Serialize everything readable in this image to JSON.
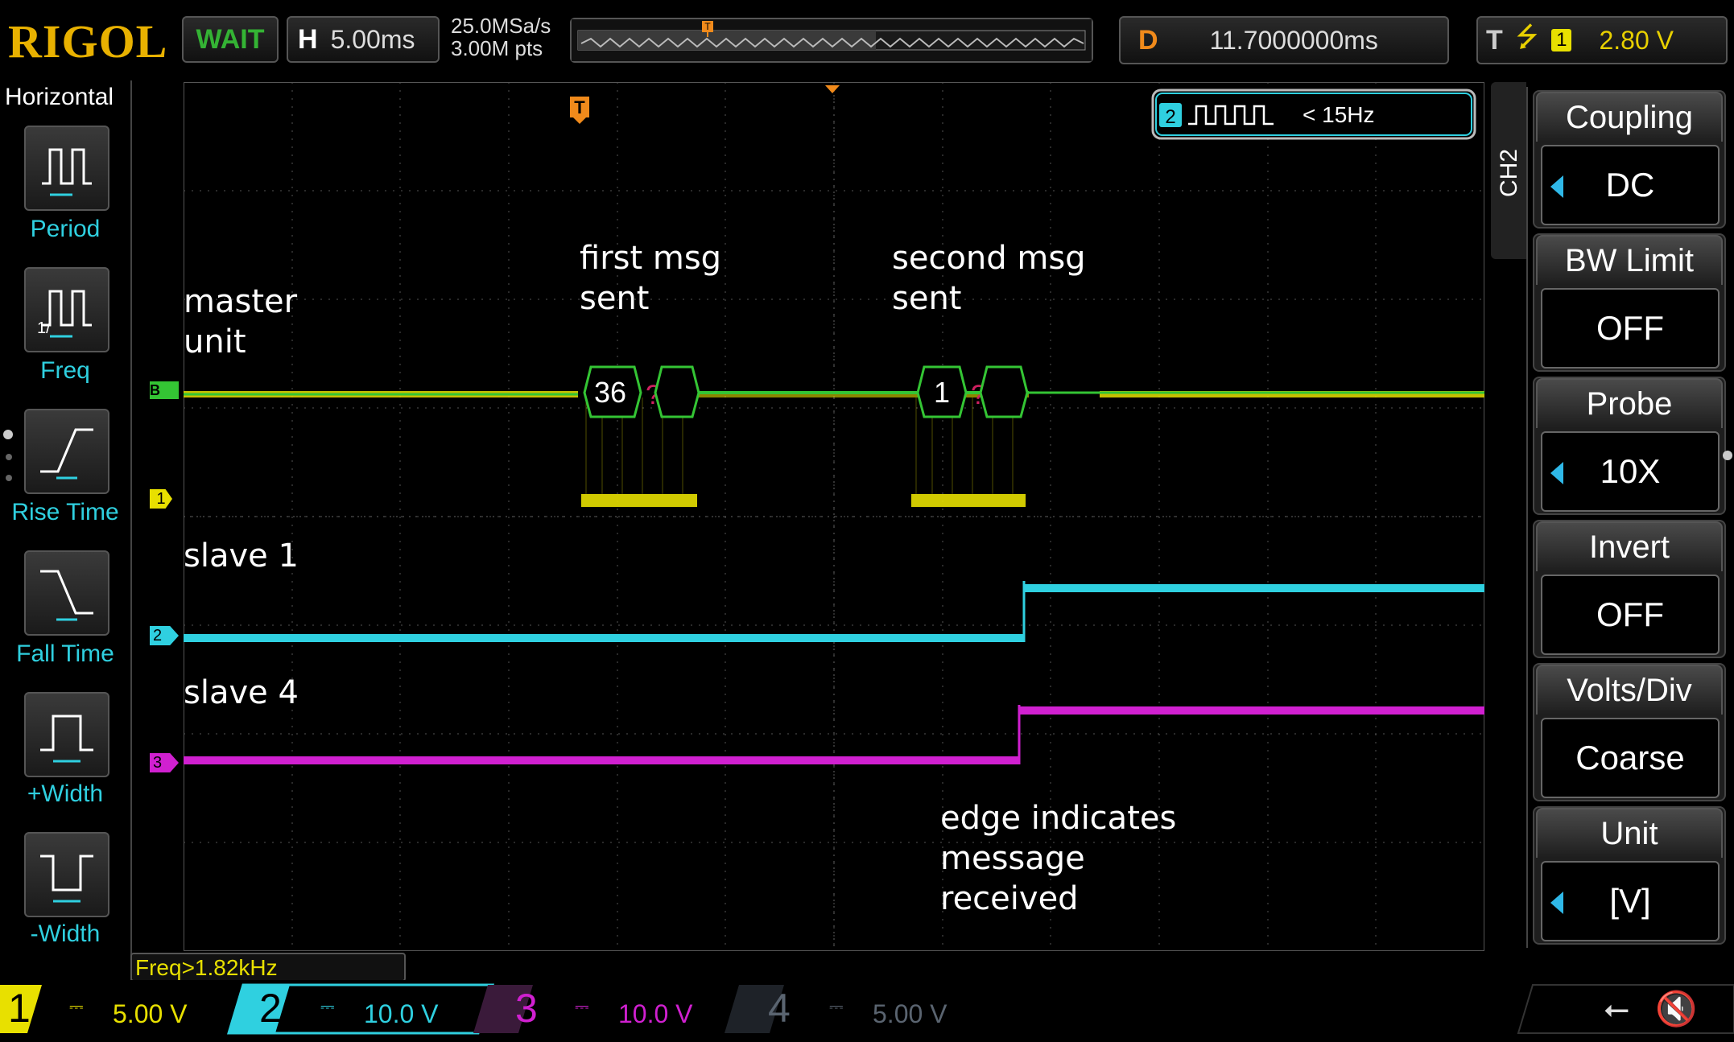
{
  "brand": "RIGOL",
  "status": "WAIT",
  "horizontal": {
    "label": "H",
    "timebase": "5.00ms",
    "sample_rate": "25.0MSa/s",
    "mem_depth": "3.00M pts"
  },
  "delay": {
    "label": "D",
    "value": "11.7000000ms"
  },
  "trigger": {
    "label": "T",
    "source": "1",
    "level": "2.80 V"
  },
  "left_menu": {
    "title": "Horizontal",
    "items": [
      {
        "label": "Period",
        "icon": "period-icon"
      },
      {
        "label": "Freq",
        "icon": "freq-icon"
      },
      {
        "label": "Rise Time",
        "icon": "rise-time-icon"
      },
      {
        "label": "Fall Time",
        "icon": "fall-time-icon"
      },
      {
        "label": "+Width",
        "icon": "plus-width-icon"
      },
      {
        "label": "-Width",
        "icon": "minus-width-icon"
      }
    ]
  },
  "freq_readout": "Freq>1.82kHz",
  "ch2_freq_badge": {
    "channel": "2",
    "value": "< 15Hz"
  },
  "decode_frames": [
    "36",
    "1"
  ],
  "annotations": {
    "master": "master\nunit",
    "first_msg": "first msg\nsent",
    "second_msg": "second msg\nsent",
    "slave1": "slave 1",
    "slave4": "slave 4",
    "edge": "edge indicates\nmessage\nreceived"
  },
  "channel_markers": {
    "bus": "B",
    "ch1": "1",
    "ch2": "2",
    "ch3": "3",
    "trig": "T"
  },
  "right_menu": {
    "channel": "CH2",
    "items": [
      {
        "title": "Coupling",
        "value": "DC",
        "arrow": true
      },
      {
        "title": "BW Limit",
        "value": "OFF",
        "arrow": false
      },
      {
        "title": "Probe",
        "value": "10X",
        "arrow": true
      },
      {
        "title": "Invert",
        "value": "OFF",
        "arrow": false
      },
      {
        "title": "Volts/Div",
        "value": "Coarse",
        "arrow": false
      },
      {
        "title": "Unit",
        "value": "[V]",
        "arrow": true
      }
    ]
  },
  "channels": [
    {
      "num": "1",
      "scale": "5.00 V",
      "color": "#e8e000",
      "active": false
    },
    {
      "num": "2",
      "scale": "10.0 V",
      "color": "#2fd0e0",
      "active": true
    },
    {
      "num": "3",
      "scale": "10.0 V",
      "color": "#d020d0",
      "active": false
    },
    {
      "num": "4",
      "scale": "5.00 V",
      "color": "#5a6470",
      "active": false
    }
  ],
  "colors": {
    "ch1": "#e8e000",
    "ch2": "#2fd0e0",
    "ch3": "#d020d0",
    "bus": "#34c534",
    "trigger": "#f08a1b"
  }
}
